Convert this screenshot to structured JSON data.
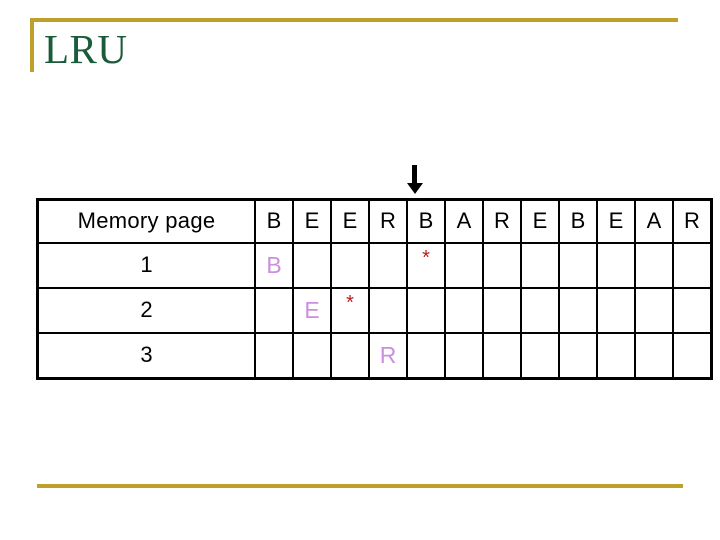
{
  "slide": {
    "title": "LRU",
    "accent_color": "#bfa02a",
    "title_color": "#1a5c3a"
  },
  "pointer": {
    "icon": "down-arrow-icon",
    "points_to_column_index": 4,
    "color": "#000000"
  },
  "table": {
    "header_label": "Memory page",
    "reference_string": [
      "B",
      "E",
      "E",
      "R",
      "B",
      "A",
      "R",
      "E",
      "B",
      "E",
      "A",
      "R"
    ],
    "row_labels": [
      "1",
      "2",
      "3"
    ],
    "letter_color": "#cc8ee0",
    "star_color": "#b81c1c",
    "star_glyph": "*",
    "rows": [
      {
        "label": "1",
        "cells": [
          {
            "text": "B",
            "kind": "letter"
          },
          {
            "text": "",
            "kind": "empty"
          },
          {
            "text": "",
            "kind": "empty"
          },
          {
            "text": "",
            "kind": "empty"
          },
          {
            "text": "*",
            "kind": "star"
          },
          {
            "text": "",
            "kind": "empty"
          },
          {
            "text": "",
            "kind": "empty"
          },
          {
            "text": "",
            "kind": "empty"
          },
          {
            "text": "",
            "kind": "empty"
          },
          {
            "text": "",
            "kind": "empty"
          },
          {
            "text": "",
            "kind": "empty"
          },
          {
            "text": "",
            "kind": "empty"
          }
        ]
      },
      {
        "label": "2",
        "cells": [
          {
            "text": "",
            "kind": "empty"
          },
          {
            "text": "E",
            "kind": "letter"
          },
          {
            "text": "*",
            "kind": "star"
          },
          {
            "text": "",
            "kind": "empty"
          },
          {
            "text": "",
            "kind": "empty"
          },
          {
            "text": "",
            "kind": "empty"
          },
          {
            "text": "",
            "kind": "empty"
          },
          {
            "text": "",
            "kind": "empty"
          },
          {
            "text": "",
            "kind": "empty"
          },
          {
            "text": "",
            "kind": "empty"
          },
          {
            "text": "",
            "kind": "empty"
          },
          {
            "text": "",
            "kind": "empty"
          }
        ]
      },
      {
        "label": "3",
        "cells": [
          {
            "text": "",
            "kind": "empty"
          },
          {
            "text": "",
            "kind": "empty"
          },
          {
            "text": "",
            "kind": "empty"
          },
          {
            "text": "R",
            "kind": "letter"
          },
          {
            "text": "",
            "kind": "empty"
          },
          {
            "text": "",
            "kind": "empty"
          },
          {
            "text": "",
            "kind": "empty"
          },
          {
            "text": "",
            "kind": "empty"
          },
          {
            "text": "",
            "kind": "empty"
          },
          {
            "text": "",
            "kind": "empty"
          },
          {
            "text": "",
            "kind": "empty"
          },
          {
            "text": "",
            "kind": "empty"
          }
        ]
      }
    ]
  }
}
